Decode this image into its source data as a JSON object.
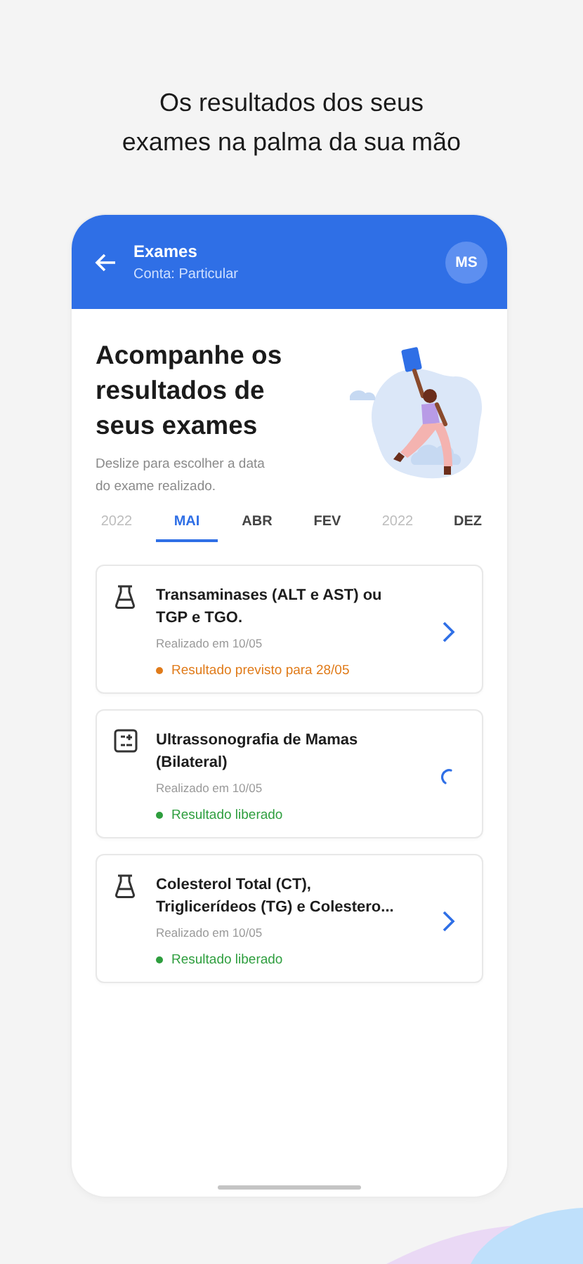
{
  "headline": [
    "Os resultados dos seus",
    "exames na palma da sua mão"
  ],
  "app_bar": {
    "title": "Exames",
    "subtitle": "Conta: Particular",
    "avatar": "MS"
  },
  "intro": {
    "title": "Acompanhe os resultados de seus exames",
    "hint": "Deslize para escolher a data do exame realizado."
  },
  "tabs": [
    {
      "label": "2022",
      "kind": "year",
      "selected": false
    },
    {
      "label": "MAI",
      "kind": "month",
      "selected": true
    },
    {
      "label": "ABR",
      "kind": "month",
      "selected": false
    },
    {
      "label": "FEV",
      "kind": "month",
      "selected": false
    },
    {
      "label": "2022",
      "kind": "year",
      "selected": false
    },
    {
      "label": "DEZ",
      "kind": "month",
      "selected": false
    }
  ],
  "exams": [
    {
      "title": "Transaminases (ALT e AST) ou TGP e TGO.",
      "kind": "lab",
      "date": "Realizado em 10/05",
      "status": "Resultado previsto para 28/05",
      "color": "#e07b1a",
      "loading": false
    },
    {
      "title": "Ultrassonografia de Mamas (Bilateral)",
      "kind": "imaging",
      "date": "Realizado em 10/05",
      "status": "Resultado liberado",
      "color": "#2e9e3e",
      "loading": true
    },
    {
      "title": "Colesterol Total (CT), Triglicerídeos (TG) e Colestero...",
      "kind": "lab",
      "date": "Realizado em 10/05",
      "status": "Resultado liberado",
      "color": "#2e9e3e",
      "loading": false
    }
  ]
}
